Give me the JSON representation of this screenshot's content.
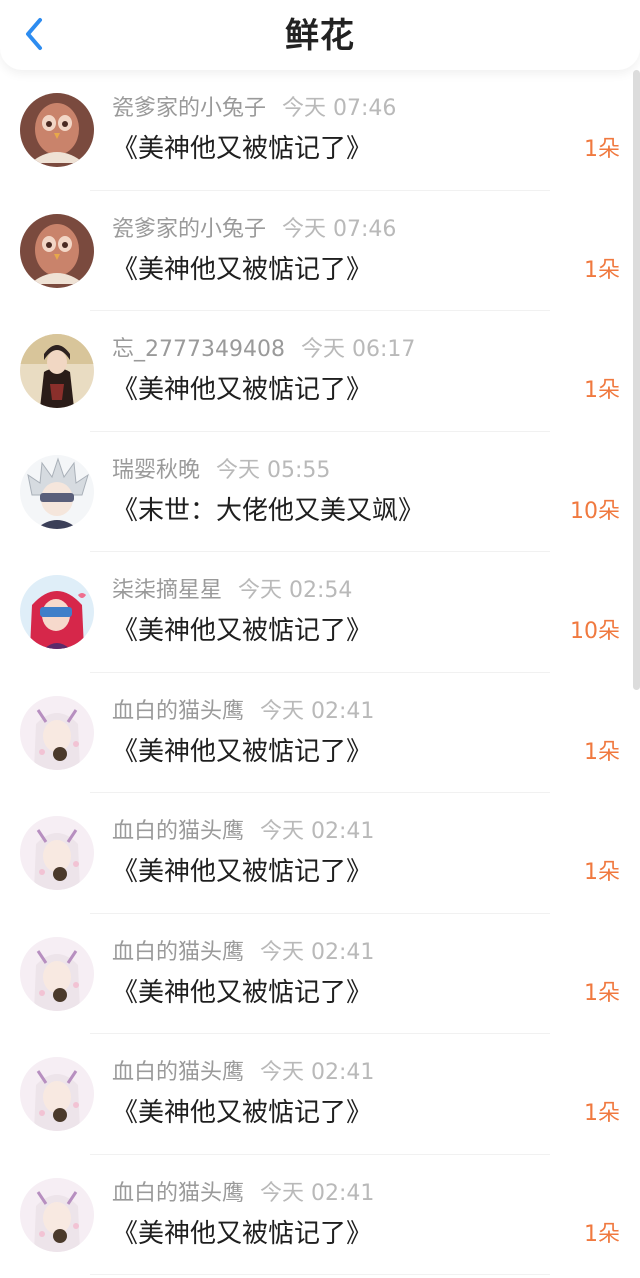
{
  "header": {
    "title": "鲜花",
    "back_icon": "chevron-left-icon",
    "accent_color": "#2d8cf0"
  },
  "count_color": "#f0793f",
  "items": [
    {
      "user": "瓷爹家的小兔子",
      "time": "今天 07:46",
      "book": "《美神他又被惦记了》",
      "count": "1朵",
      "avatar": "owl-brown"
    },
    {
      "user": "瓷爹家的小兔子",
      "time": "今天 07:46",
      "book": "《美神他又被惦记了》",
      "count": "1朵",
      "avatar": "owl-brown"
    },
    {
      "user": "忘_2777349408",
      "time": "今天 06:17",
      "book": "《美神他又被惦记了》",
      "count": "1朵",
      "avatar": "dark-robe"
    },
    {
      "user": "瑞婴秋晚",
      "time": "今天 05:55",
      "book": "《末世：大佬他又美又飒》",
      "count": "10朵",
      "avatar": "white-hair"
    },
    {
      "user": "柒柒摘星星",
      "time": "今天 02:54",
      "book": "《美神他又被惦记了》",
      "count": "10朵",
      "avatar": "red-hair"
    },
    {
      "user": "血白的猫头鹰",
      "time": "今天 02:41",
      "book": "《美神他又被惦记了》",
      "count": "1朵",
      "avatar": "pastel"
    },
    {
      "user": "血白的猫头鹰",
      "time": "今天 02:41",
      "book": "《美神他又被惦记了》",
      "count": "1朵",
      "avatar": "pastel"
    },
    {
      "user": "血白的猫头鹰",
      "time": "今天 02:41",
      "book": "《美神他又被惦记了》",
      "count": "1朵",
      "avatar": "pastel"
    },
    {
      "user": "血白的猫头鹰",
      "time": "今天 02:41",
      "book": "《美神他又被惦记了》",
      "count": "1朵",
      "avatar": "pastel"
    },
    {
      "user": "血白的猫头鹰",
      "time": "今天 02:41",
      "book": "《美神他又被惦记了》",
      "count": "1朵",
      "avatar": "pastel"
    }
  ]
}
